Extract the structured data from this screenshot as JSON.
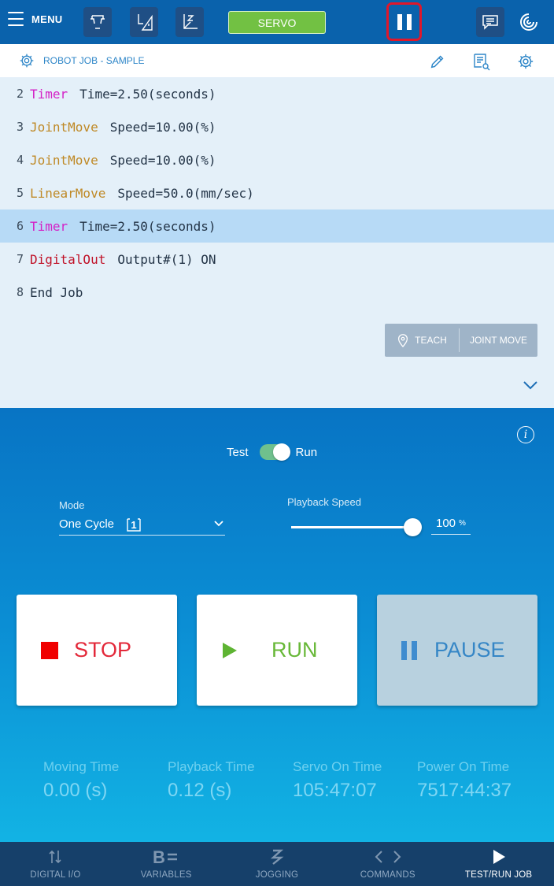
{
  "topbar": {
    "menu_label": "MENU",
    "servo_label": "SERVO",
    "colors": {
      "bar": "#0a62ac",
      "servo": "#72c143",
      "pause_highlight": "#e1172a"
    }
  },
  "job": {
    "title": "ROBOT JOB - SAMPLE"
  },
  "code": {
    "lines": [
      {
        "num": "2",
        "cmd": "Timer",
        "args": "Time=2.50(seconds)"
      },
      {
        "num": "3",
        "cmd": "JointMove",
        "args": "Speed=10.00(%)"
      },
      {
        "num": "4",
        "cmd": "JointMove",
        "args": "Speed=10.00(%)"
      },
      {
        "num": "5",
        "cmd": "LinearMove",
        "args": "Speed=50.0(mm/sec)"
      },
      {
        "num": "6",
        "cmd": "Timer",
        "args": "Time=2.50(seconds)"
      },
      {
        "num": "7",
        "cmd": "DigitalOut",
        "args": "Output#(1)  ON"
      },
      {
        "num": "8",
        "cmd": "",
        "args": "End Job"
      }
    ],
    "selected_line": "6",
    "teach_label": "TEACH",
    "joint_move_label": "JOINT MOVE"
  },
  "run_panel": {
    "info_label": "i",
    "toggle": {
      "left_label": "Test",
      "right_label": "Run",
      "value": "Run"
    },
    "mode": {
      "label": "Mode",
      "value": "One Cycle",
      "icon_text": "1"
    },
    "playback_speed": {
      "label": "Playback Speed",
      "value": "100",
      "unit": "%",
      "fraction": 1.0
    },
    "buttons": {
      "stop": "STOP",
      "run": "RUN",
      "pause": "PAUSE"
    },
    "stats": [
      {
        "label": "Moving Time",
        "value": "0.00 (s)"
      },
      {
        "label": "Playback Time",
        "value": "0.12 (s)"
      },
      {
        "label": "Servo On Time",
        "value": "105:47:07"
      },
      {
        "label": "Power On Time",
        "value": "7517:44:37"
      }
    ]
  },
  "bottom_nav": {
    "items": [
      {
        "label": "DIGITAL I/O",
        "icon": "digital-io-icon"
      },
      {
        "label": "VARIABLES",
        "icon": "variables-icon"
      },
      {
        "label": "JOGGING",
        "icon": "jogging-icon"
      },
      {
        "label": "COMMANDS",
        "icon": "commands-icon"
      },
      {
        "label": "TEST/RUN JOB",
        "icon": "play-icon"
      }
    ],
    "active": "TEST/RUN JOB"
  }
}
